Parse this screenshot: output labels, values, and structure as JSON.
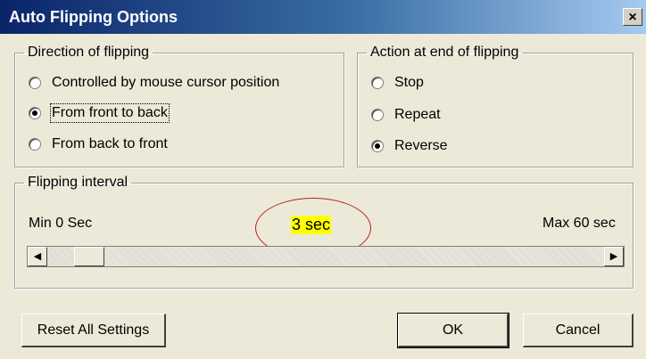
{
  "window": {
    "title": "Auto Flipping Options",
    "close_glyph": "×"
  },
  "direction_group": {
    "legend": "Direction of flipping",
    "options": [
      {
        "label": "Controlled by mouse cursor position",
        "checked": false
      },
      {
        "label": "From front to back",
        "checked": true
      },
      {
        "label": "From back to front",
        "checked": false
      }
    ]
  },
  "end_action_group": {
    "legend": "Action at end of flipping",
    "options": [
      {
        "label": "Stop",
        "checked": false
      },
      {
        "label": "Repeat",
        "checked": false
      },
      {
        "label": "Reverse",
        "checked": true
      }
    ]
  },
  "interval_group": {
    "legend": "Flipping interval",
    "min_label": "Min 0 Sec",
    "max_label": "Max 60 sec",
    "current_label": "3 sec",
    "current_value": 3,
    "min": 0,
    "max": 60,
    "highlight_color": "#ffff00",
    "annotation_color": "#b22222",
    "left_arrow": "◀",
    "right_arrow": "▶"
  },
  "buttons": {
    "reset": "Reset All Settings",
    "ok": "OK",
    "cancel": "Cancel"
  }
}
